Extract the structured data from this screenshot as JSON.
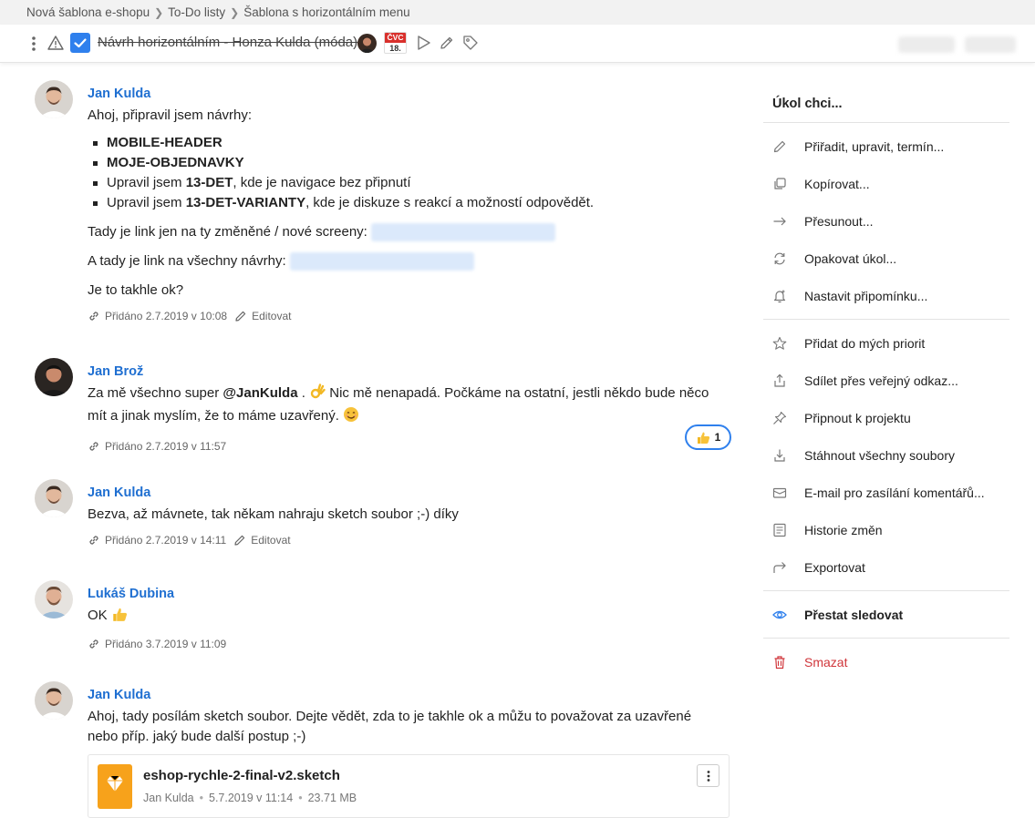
{
  "breadcrumb": [
    "Nová šablona e-shopu",
    "To-Do listy",
    "Šablona s horizontálním menu"
  ],
  "toolbar": {
    "title": "Návrh horizontálním - Honza Kulda (móda)",
    "calendar_month": "ČVC",
    "calendar_day": "18."
  },
  "comments": [
    {
      "author": "Jan Kulda",
      "intro": "Ahoj, připravil jsem návrhy:",
      "bullets": {
        "b1": "MOBILE-HEADER",
        "b2": "MOJE-OBJEDNAVKY",
        "b3_pre": "Upravil jsem ",
        "b3_bold": "13-DET",
        "b3_post": ", kde je navigace bez připnutí",
        "b4_pre": "Upravil jsem ",
        "b4_bold": "13-DET-VARIANTY",
        "b4_post": ", kde je diskuze s reakcí a možností odpovědět."
      },
      "p1": "Tady je link jen na ty změněné / nové screeny:",
      "p2": "A tady je link na všechny návrhy:",
      "p3": "Je to takhle ok?",
      "added": "Přidáno 2.7.2019 v 10:08",
      "edit": "Editovat"
    },
    {
      "author": "Jan Brož",
      "text_pre": "Za mě všechno super ",
      "mention": "@JanKulda",
      "text_mid": " . ",
      "text_post": " Nic mě nenapadá. Počkáme na ostatní, jestli někdo bude něco mít a jinak myslím, že to máme uzavřený. ",
      "added": "Přidáno 2.7.2019 v 11:57",
      "reaction_count": "1"
    },
    {
      "author": "Jan Kulda",
      "text": "Bezva, až mávnete, tak někam nahraju sketch soubor ;-) díky",
      "added": "Přidáno 2.7.2019 v 14:11",
      "edit": "Editovat"
    },
    {
      "author": "Lukáš Dubina",
      "text": "OK",
      "added": "Přidáno 3.7.2019 v 11:09"
    },
    {
      "author": "Jan Kulda",
      "text": "Ahoj, tady posílám sketch soubor. Dejte vědět, zda to je takhle ok a můžu to považovat za uzavřené nebo příp. jaký bude další postup ;-)",
      "attachment": {
        "name": "eshop-rychle-2-final-v2.sketch",
        "uploader": "Jan Kulda",
        "date": "5.7.2019 v 11:14",
        "size": "23.71 MB"
      }
    }
  ],
  "sidebar": {
    "title": "Úkol chci...",
    "group1": [
      {
        "label": "Přiřadit, upravit, termín...",
        "icon": "pencil-icon"
      },
      {
        "label": "Kopírovat...",
        "icon": "copy-icon"
      },
      {
        "label": "Přesunout...",
        "icon": "arrow-right-icon"
      },
      {
        "label": "Opakovat úkol...",
        "icon": "repeat-icon"
      },
      {
        "label": "Nastavit připomínku...",
        "icon": "bell-icon"
      }
    ],
    "group2": [
      {
        "label": "Přidat do mých priorit",
        "icon": "star-icon"
      },
      {
        "label": "Sdílet přes veřejný odkaz...",
        "icon": "share-icon"
      },
      {
        "label": "Připnout k projektu",
        "icon": "pin-icon"
      },
      {
        "label": "Stáhnout všechny soubory",
        "icon": "download-icon"
      },
      {
        "label": "E-mail pro zasílání komentářů...",
        "icon": "email-icon"
      },
      {
        "label": "Historie změn",
        "icon": "history-icon"
      },
      {
        "label": "Exportovat",
        "icon": "export-icon"
      }
    ],
    "unfollow": "Přestat sledovat",
    "delete": "Smazat"
  },
  "colors": {
    "accent": "#2f80ed",
    "author_link": "#1f6fd1",
    "danger": "#d0353a",
    "calendar_red": "#d9302c",
    "sketch_orange": "#f7a21b"
  }
}
